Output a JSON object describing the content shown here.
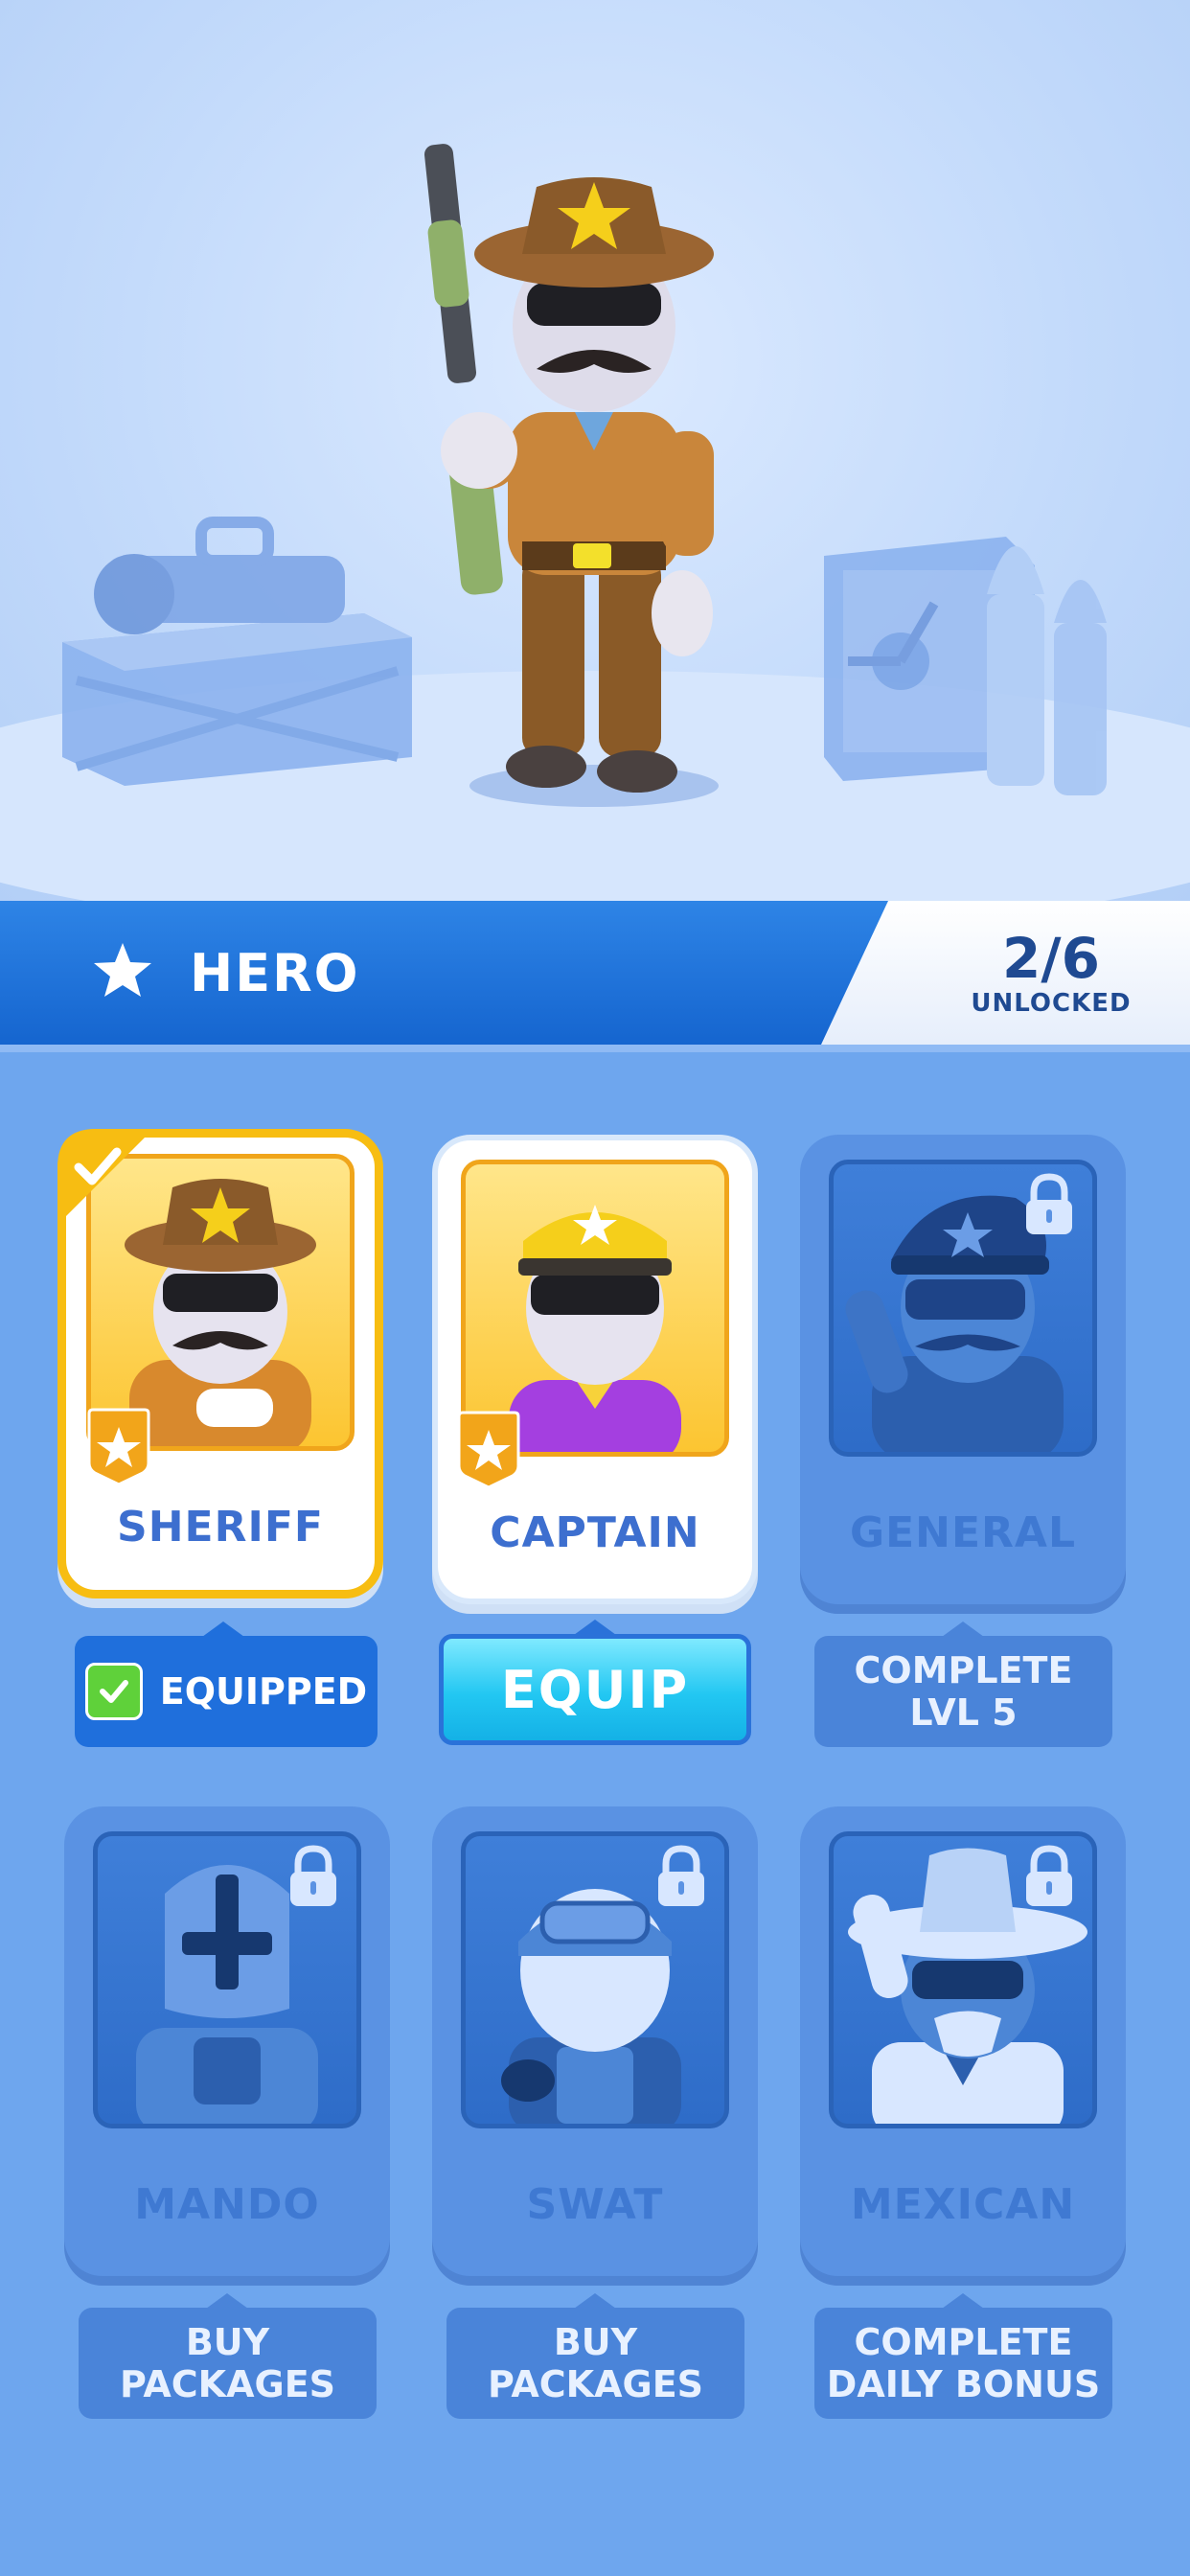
{
  "header": {
    "section_title": "HERO",
    "unlock_count": "2/6",
    "unlock_label": "UNLOCKED",
    "star_icon": "star-icon"
  },
  "characters": [
    {
      "name": "SHERIFF",
      "state": "equipped",
      "action_label": "EQUIPPED"
    },
    {
      "name": "CAPTAIN",
      "state": "unlocked",
      "action_label": "EQUIP"
    },
    {
      "name": "GENERAL",
      "state": "locked",
      "action_label": "COMPLETE\nLVL 5"
    },
    {
      "name": "MANDO",
      "state": "locked",
      "action_label": "BUY\nPACKAGES"
    },
    {
      "name": "SWAT",
      "state": "locked",
      "action_label": "BUY\nPACKAGES"
    },
    {
      "name": "MEXICAN",
      "state": "locked",
      "action_label": "COMPLETE\nDAILY BONUS"
    }
  ],
  "colors": {
    "background": "#6ea6ee",
    "header_blue": "#1565cf",
    "gold": "#f7bd12",
    "equip_cyan": "#22c7f2"
  }
}
